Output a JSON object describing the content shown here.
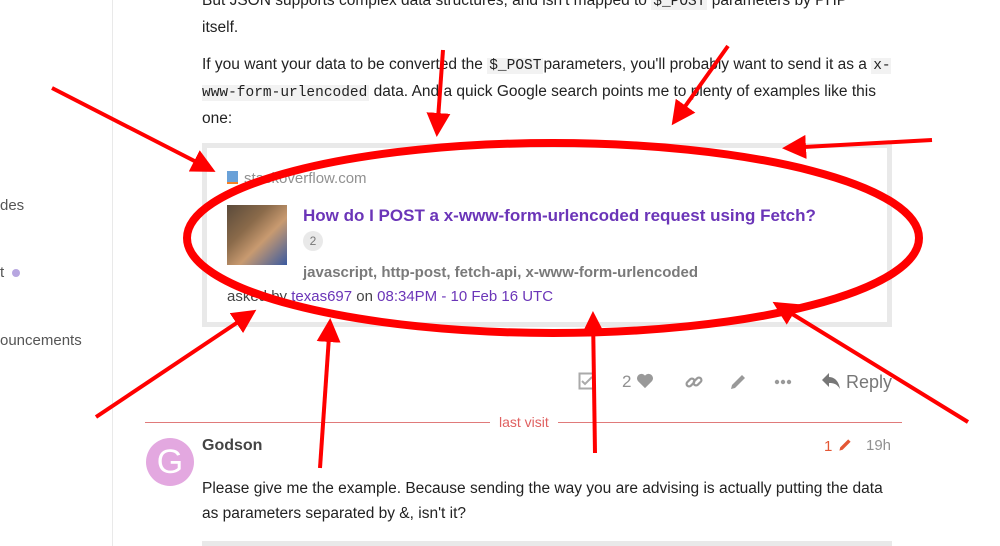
{
  "sidebar": {
    "items": [
      {
        "label": "des"
      },
      {
        "label": "t"
      },
      {
        "label": "ouncements"
      }
    ]
  },
  "post": {
    "line_top_a": "But JSON supports complex data structures, and isn't mapped to",
    "line_top_code": "$_POST",
    "line_top_b": "parameters by PHP",
    "line_top_c": "itself.",
    "p2_a": "If you want your data to be converted the",
    "p2_code1": "$_POST",
    "p2_b": "parameters, you'll probably want to send it as a",
    "p2_code2": "x-www-form-urlencoded",
    "p2_c": "data. And a quick Google search points me to plenty of examples like this one:"
  },
  "onebox": {
    "source": "stackoverflow.com",
    "title": "How do I POST a x-www-form-urlencoded request using Fetch?",
    "answer_count": "2",
    "tags": "javascript, http-post, fetch-api, x-www-form-urlencoded",
    "asked_by_label": "asked by",
    "author": "texas697",
    "on_label": "on",
    "date": "08:34PM - 10 Feb 16 UTC"
  },
  "actions": {
    "like_count": "2",
    "reply_label": "Reply"
  },
  "last_visit": "last visit",
  "reply_post": {
    "avatar_letter": "G",
    "username": "Godson",
    "edit_count": "1",
    "age": "19h",
    "body": "Please give me the example. Because sending the way you are advising is actually putting the data as parameters separated by &, isn't it?"
  },
  "colors": {
    "link": "#6b35b8",
    "annotation": "#ff0000",
    "last_visit": "#e06060",
    "avatar": "#e3a8e0"
  }
}
